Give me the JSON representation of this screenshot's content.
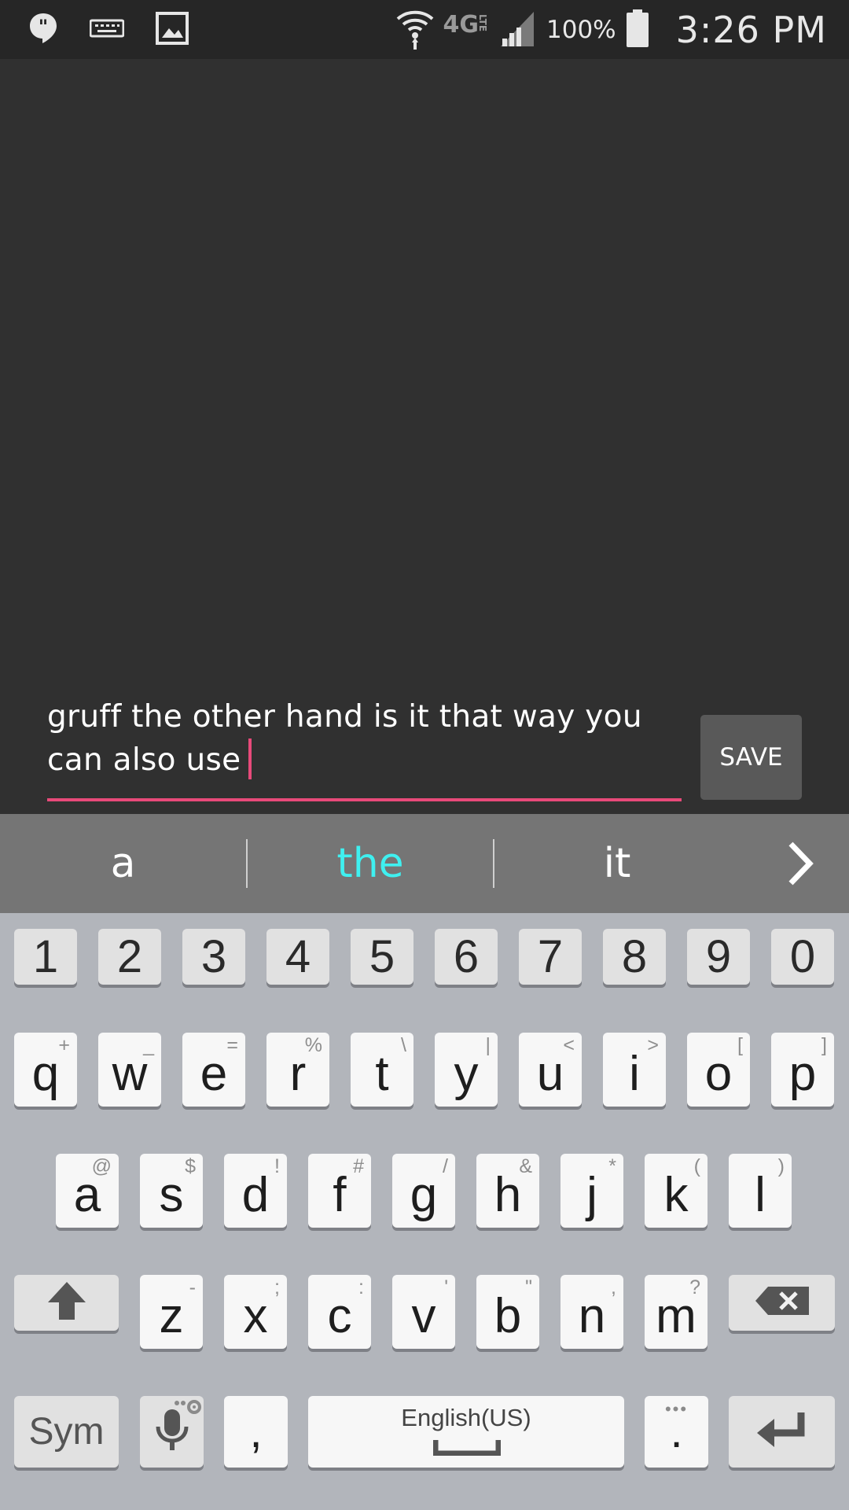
{
  "status_bar": {
    "left_icons": [
      "hangouts-icon",
      "keyboard-icon",
      "image-icon"
    ],
    "network": "4G",
    "network_sub": "LTE",
    "battery": "100%",
    "time": "3:26 PM"
  },
  "composer": {
    "text": "gruff the other hand is it that way you can also use",
    "save_label": "SAVE",
    "accent": "#e84a7a"
  },
  "suggestions": {
    "items": [
      "a",
      "the",
      "it"
    ],
    "highlight": "the",
    "highlight_color": "#3ff0f0",
    "more_icon": "chevron-right-icon"
  },
  "keyboard": {
    "numbers": [
      "1",
      "2",
      "3",
      "4",
      "5",
      "6",
      "7",
      "8",
      "9",
      "0"
    ],
    "row1": [
      [
        "q",
        "+"
      ],
      [
        "w",
        "_"
      ],
      [
        "e",
        "="
      ],
      [
        "r",
        "%"
      ],
      [
        "t",
        "\\"
      ],
      [
        "y",
        "|"
      ],
      [
        "u",
        "<"
      ],
      [
        "i",
        ">"
      ],
      [
        "o",
        "["
      ],
      [
        "p",
        "]"
      ]
    ],
    "row2": [
      [
        "a",
        "@"
      ],
      [
        "s",
        "$"
      ],
      [
        "d",
        "!"
      ],
      [
        "f",
        "#"
      ],
      [
        "g",
        "/"
      ],
      [
        "h",
        "&"
      ],
      [
        "j",
        "*"
      ],
      [
        "k",
        "("
      ],
      [
        "l",
        ")"
      ]
    ],
    "row3": [
      [
        "z",
        "-"
      ],
      [
        "x",
        ";"
      ],
      [
        "c",
        ":"
      ],
      [
        "v",
        "'"
      ],
      [
        "b",
        "\""
      ],
      [
        "n",
        ","
      ],
      [
        "m",
        "?"
      ]
    ],
    "sym_label": "Sym",
    "comma": ",",
    "space_label": "English(US)",
    "period": ".",
    "shift_icon": "shift-arrow-icon",
    "backspace_icon": "backspace-icon",
    "enter_icon": "enter-icon",
    "mic_icon": "microphone-icon"
  }
}
